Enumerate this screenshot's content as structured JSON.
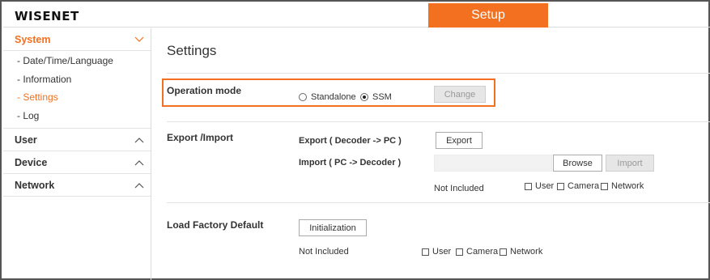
{
  "brand": {
    "logo": "WISENET"
  },
  "header": {
    "setup_tab": "Setup"
  },
  "colors": {
    "accent": "#f37021"
  },
  "sidebar": {
    "sections": [
      {
        "label": "System",
        "expanded": true,
        "icon": "chevron-down-icon",
        "items": [
          "- Date/Time/Language",
          "- Information",
          "- Settings",
          "- Log"
        ],
        "active_item": "- Settings"
      },
      {
        "label": "User",
        "expanded": false,
        "icon": "chevron-up-icon"
      },
      {
        "label": "Device",
        "expanded": false,
        "icon": "chevron-up-icon"
      },
      {
        "label": "Network",
        "expanded": false,
        "icon": "chevron-up-icon"
      }
    ]
  },
  "main": {
    "title": "Settings",
    "operation_mode": {
      "label": "Operation mode",
      "options": [
        "Standalone",
        "SSM"
      ],
      "selected": "SSM",
      "change_button": "Change"
    },
    "export_import": {
      "label": "Export /Import",
      "export_label": "Export ( Decoder -> PC )",
      "export_button": "Export",
      "import_label": "Import ( PC -> Decoder )",
      "browse_button": "Browse",
      "import_button": "Import",
      "not_included": "Not Included",
      "checks": [
        "User",
        "Camera",
        "Network"
      ]
    },
    "factory_default": {
      "label": "Load Factory Default",
      "init_button": "Initialization",
      "not_included": "Not Included",
      "checks": [
        "User",
        "Camera",
        "Network"
      ]
    }
  }
}
